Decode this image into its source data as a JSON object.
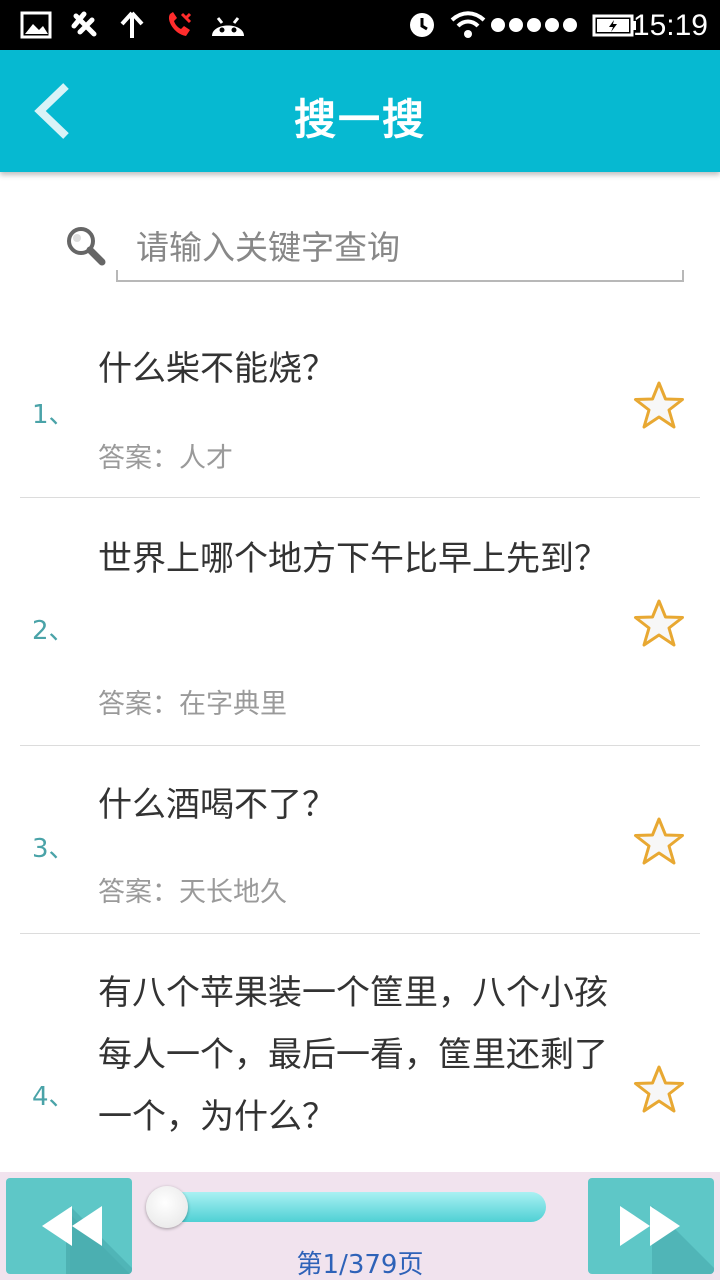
{
  "status_bar": {
    "time": "15:19",
    "icons": [
      "gallery-icon",
      "usb-debug-icon",
      "upload-arrow-icon",
      "missed-call-icon",
      "android-icon",
      "alarm-icon",
      "wifi-icon",
      "signal-dots-icon",
      "battery-icon"
    ]
  },
  "header": {
    "title": "搜一搜",
    "back_icon": "chevron-left-icon"
  },
  "search": {
    "placeholder": "请输入关键字查询",
    "value": ""
  },
  "items": [
    {
      "index": "1、",
      "question": "什么柴不能烧？",
      "answer": "答案：人才"
    },
    {
      "index": "2、",
      "question": "世界上哪个地方下午比早上先到？",
      "answer": "答案：在字典里"
    },
    {
      "index": "3、",
      "question": "什么酒喝不了？",
      "answer": "答案：天长地久"
    },
    {
      "index": "4、",
      "question": "有八个苹果装一个筐里，八个小孩每人一个，最后一看，筐里还剩了一个，为什么？",
      "answer": ""
    }
  ],
  "pager": {
    "page_label": "第1/379页",
    "progress_fraction": 0.0
  },
  "colors": {
    "header": "#06b9d1",
    "nav_button": "#5ec7c7",
    "star_outline": "#e8a832",
    "page_label": "#2e62b8"
  }
}
